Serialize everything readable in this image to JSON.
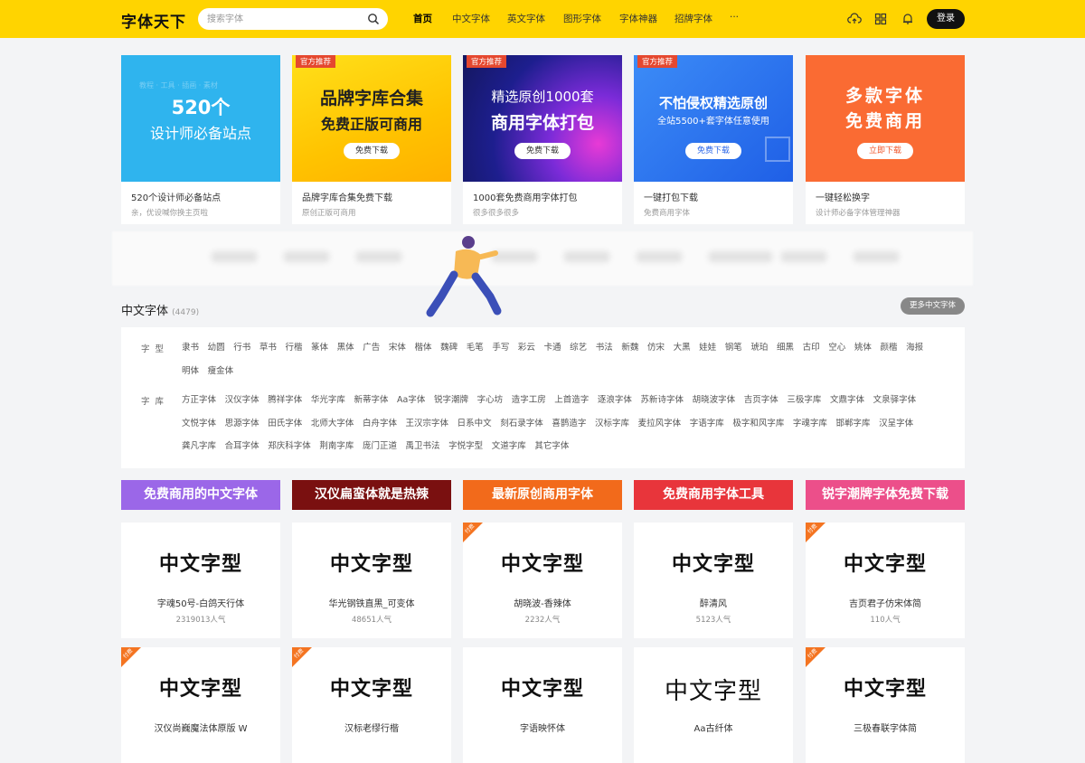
{
  "header": {
    "logo": "字体天下",
    "search_placeholder": "搜索字体",
    "nav": [
      "首页",
      "中文字体",
      "英文字体",
      "图形字体",
      "字体神器",
      "招牌字体",
      "···"
    ],
    "login": "登录"
  },
  "banners": [
    {
      "tag": "",
      "line1": "520个",
      "line2": "设计师必备站点",
      "button": "",
      "title": "520个设计师必备站点",
      "sub": "亲，优设喊你换主页啦"
    },
    {
      "tag": "官方推荐",
      "line1": "品牌字库合集",
      "line2": "免费正版可商用",
      "button": "免费下载",
      "title": "品牌字库合集免费下载",
      "sub": "原创正版可商用"
    },
    {
      "tag": "官方推荐",
      "line1": "精选原创1000套",
      "line2": "商用字体打包",
      "button": "免费下载",
      "title": "1000套免费商用字体打包",
      "sub": "很多很多很多"
    },
    {
      "tag": "官方推荐",
      "line1": "不怕侵权精选原创",
      "line2": "全站5500+套字体任意使用",
      "button": "免费下载",
      "title": "一键打包下载",
      "sub": "免费商用字体"
    },
    {
      "tag": "",
      "line1": "多款字体",
      "line2": "免费商用",
      "button": "立即下载",
      "title": "一键轻松换字",
      "sub": "设计师必备字体管理神器"
    }
  ],
  "section": {
    "title": "中文字体",
    "count": "(4479)",
    "more": "更多中文字体"
  },
  "filters": {
    "type_label": "字型",
    "type_items": [
      "隶书",
      "幼圆",
      "行书",
      "草书",
      "行楷",
      "篆体",
      "黑体",
      "广告",
      "宋体",
      "楷体",
      "魏碑",
      "毛笔",
      "手写",
      "彩云",
      "卡通",
      "综艺",
      "书法",
      "新魏",
      "仿宋",
      "大黑",
      "娃娃",
      "钢笔",
      "琥珀",
      "细黑",
      "古印",
      "空心",
      "姚体",
      "颜楷",
      "海报",
      "明体",
      "瘦金体"
    ],
    "lib_label": "字库",
    "lib_items": [
      "方正字体",
      "汉仪字体",
      "腾祥字体",
      "华光字库",
      "新蒂字体",
      "Aa字体",
      "锐字潮牌",
      "字心坊",
      "造字工房",
      "上首造字",
      "逐浪字体",
      "苏新诗字体",
      "胡晓波字体",
      "吉页字体",
      "三极字库",
      "文鼎字体",
      "文泉驿字体",
      "文悦字体",
      "思源字体",
      "田氏字体",
      "北师大字体",
      "白舟字体",
      "王汉宗字体",
      "日系中文",
      "刻石录字体",
      "喜鹊造字",
      "汉标字库",
      "麦拉风字体",
      "字语字库",
      "极字和风字库",
      "字魂字库",
      "邯郸字库",
      "汉呈字体",
      "龚凡字库",
      "合耳字体",
      "郑庆科字体",
      "荆南字库",
      "庞门正道",
      "禹卫书法",
      "字悦字型",
      "文道字库",
      "其它字体"
    ]
  },
  "promos": [
    {
      "text": "免费商用的中文字体",
      "color": "#9b67e8"
    },
    {
      "text": "汉仪扁蛮体就是热辣",
      "color": "#7a1010"
    },
    {
      "text": "最新原创商用字体",
      "color": "#f26a1b"
    },
    {
      "text": "免费商用字体工具",
      "color": "#e8353b"
    },
    {
      "text": "锐字潮牌字体免费下载",
      "color": "#ec4f8a"
    }
  ],
  "font_cards": [
    {
      "sample": "中文字型",
      "name": "字魂50号-白鸽天行体",
      "pop": "2319013人气",
      "badge": ""
    },
    {
      "sample": "中文字型",
      "name": "华光钢铁直黑_可变体",
      "pop": "48651人气",
      "badge": ""
    },
    {
      "sample": "中文字型",
      "name": "胡晓波-香辣体",
      "pop": "2232人气",
      "badge": "付费"
    },
    {
      "sample": "中文字型",
      "name": "醉清风",
      "pop": "5123人气",
      "badge": ""
    },
    {
      "sample": "中文字型",
      "name": "吉页君子仿宋体简",
      "pop": "110人气",
      "badge": "付费"
    },
    {
      "sample": "中文字型",
      "name": "汉仪尚巍魔法体原版 W",
      "pop": "",
      "badge": "付费"
    },
    {
      "sample": "中文字型",
      "name": "汉标老缪行楷",
      "pop": "",
      "badge": "付费"
    },
    {
      "sample": "中文字型",
      "name": "字语映怀体",
      "pop": "",
      "badge": ""
    },
    {
      "sample": "中文字型",
      "name": "Aa古纤体",
      "pop": "",
      "badge": ""
    },
    {
      "sample": "中文字型",
      "name": "三极春联字体简",
      "pop": "",
      "badge": "付费"
    }
  ]
}
